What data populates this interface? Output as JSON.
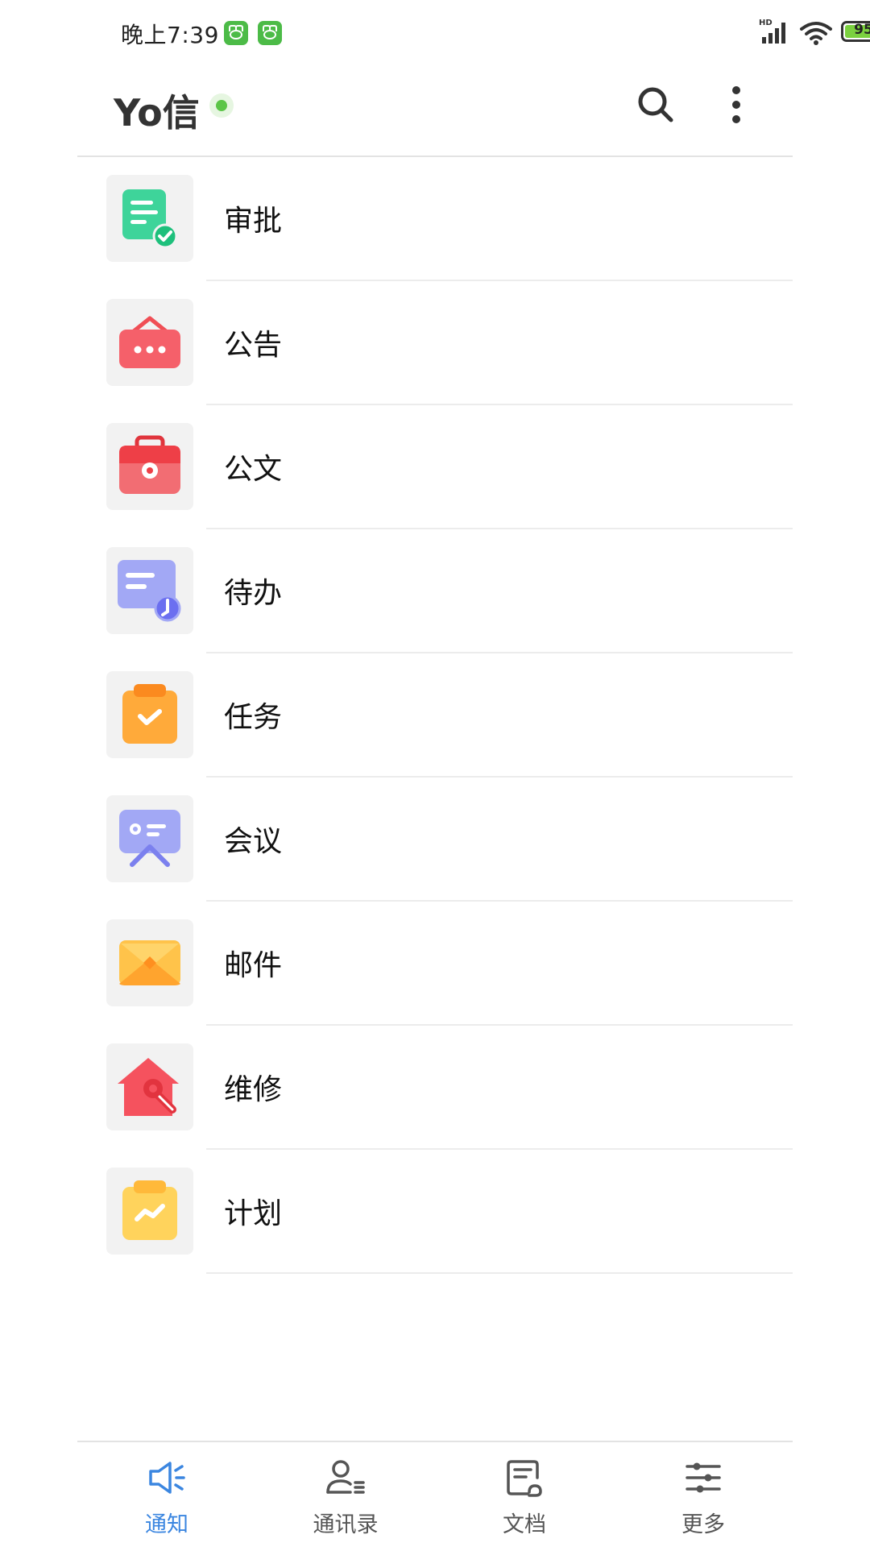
{
  "status_bar": {
    "time": "晚上7:39",
    "network_label": "HD",
    "battery_level": 95,
    "battery_text": "95",
    "charging": true
  },
  "header": {
    "title": "Yo信",
    "online_status_color": "#5cc548",
    "search_icon": "search-icon",
    "more_icon": "more-vertical-icon"
  },
  "menu": {
    "items": [
      {
        "label": "审批",
        "icon": "approval-icon",
        "color": "#3ed49a"
      },
      {
        "label": "公告",
        "icon": "announcement-icon",
        "color": "#f5606a"
      },
      {
        "label": "公文",
        "icon": "document-bag-icon",
        "color": "#f04e55"
      },
      {
        "label": "待办",
        "icon": "todo-icon",
        "color": "#8e96f2"
      },
      {
        "label": "任务",
        "icon": "task-icon",
        "color": "#ffa93a"
      },
      {
        "label": "会议",
        "icon": "meeting-icon",
        "color": "#9aa2f5"
      },
      {
        "label": "邮件",
        "icon": "mail-icon",
        "color": "#ffc34a"
      },
      {
        "label": "维修",
        "icon": "repair-icon",
        "color": "#f5525e"
      },
      {
        "label": "计划",
        "icon": "plan-icon",
        "color": "#ffd35c"
      }
    ]
  },
  "tabs": [
    {
      "label": "通知",
      "icon": "megaphone-icon",
      "active": true
    },
    {
      "label": "通讯录",
      "icon": "contacts-icon",
      "active": false
    },
    {
      "label": "文档",
      "icon": "document-icon",
      "active": false
    },
    {
      "label": "更多",
      "icon": "sliders-icon",
      "active": false
    }
  ],
  "colors": {
    "accent": "#3b86e0",
    "divider": "#ececec"
  }
}
